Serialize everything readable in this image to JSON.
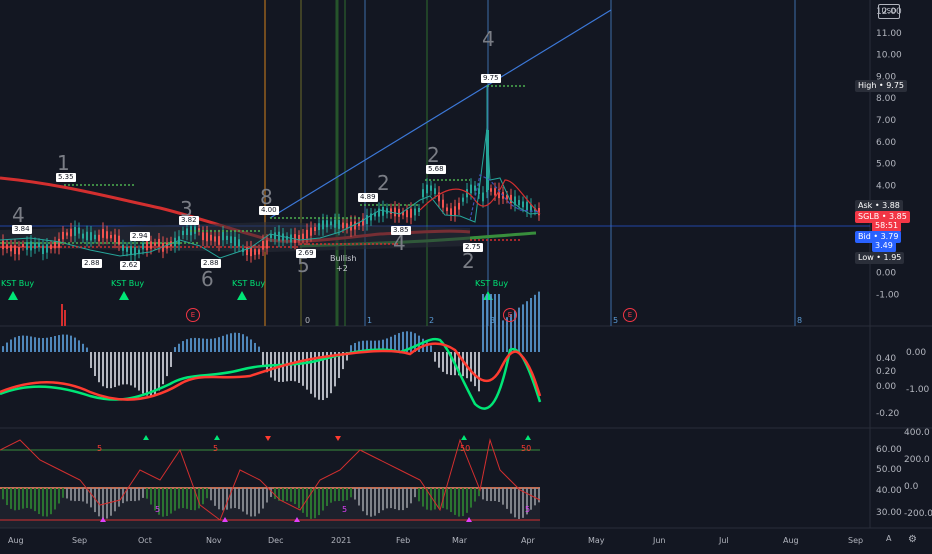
{
  "header": {
    "currency": "USD"
  },
  "price_axis": {
    "ticks": [
      "12.00",
      "11.00",
      "10.00",
      "9.00",
      "8.00",
      "7.00",
      "6.00",
      "5.00",
      "4.00",
      "3.00",
      "2.00",
      "1.00",
      "0.00",
      "-1.00"
    ],
    "labels": [
      {
        "name": "High",
        "value": "9.75",
        "color": "#2a2e39"
      },
      {
        "name": "Ask",
        "value": "3.88",
        "color": "#2a2e39"
      },
      {
        "name": "SGLB",
        "value": "3.85",
        "color": "#f23645"
      },
      {
        "name": "",
        "value": "58:51",
        "color": "#f23645"
      },
      {
        "name": "Bid",
        "value": "3.79",
        "color": "#2962ff"
      },
      {
        "name": "",
        "value": "3.49",
        "color": "#2962ff"
      },
      {
        "name": "Low",
        "value": "1.95",
        "color": "#2a2e39"
      }
    ]
  },
  "osc1_axis": {
    "left_ticks": [
      "0.40",
      "0.20",
      "0.00",
      "-0.20"
    ],
    "right_ticks": [
      "0.00",
      "-1.00"
    ]
  },
  "osc2_axis": {
    "left_ticks": [
      "60.00",
      "50.00",
      "40.00",
      "30.00"
    ],
    "right_ticks": [
      "400.0",
      "200.0",
      "0.0",
      "-200.0"
    ]
  },
  "time_axis": {
    "months": [
      "Aug",
      "Sep",
      "Oct",
      "Nov",
      "Dec",
      "2021",
      "Feb",
      "Mar",
      "Apr",
      "May",
      "Jun",
      "Jul",
      "Aug",
      "Sep"
    ]
  },
  "annotations": {
    "kst_buy": "KST Buy",
    "bullish": "Bullish",
    "bullish_sub": "+2",
    "wave_counts": [
      "1",
      "4",
      "3",
      "6",
      "8",
      "5",
      "2",
      "4",
      "2",
      "4",
      "2"
    ],
    "price_tags": [
      "5.35",
      "3.84",
      "2.88",
      "2.62",
      "2.94",
      "3.82",
      "2.88",
      "2.69",
      "4.00",
      "4.89",
      "3.85",
      "5.68",
      "2.75",
      "9.75"
    ],
    "earnings": "E",
    "cycle_numbers": [
      "0",
      "1",
      "2",
      "3",
      "5",
      "8"
    ],
    "osc2_tags": [
      "5",
      "5",
      "5",
      "5",
      "5",
      "50",
      "50"
    ]
  },
  "footer": {
    "left_icon": "expand-icon",
    "log_btn": "A",
    "settings": "gear-icon"
  }
}
